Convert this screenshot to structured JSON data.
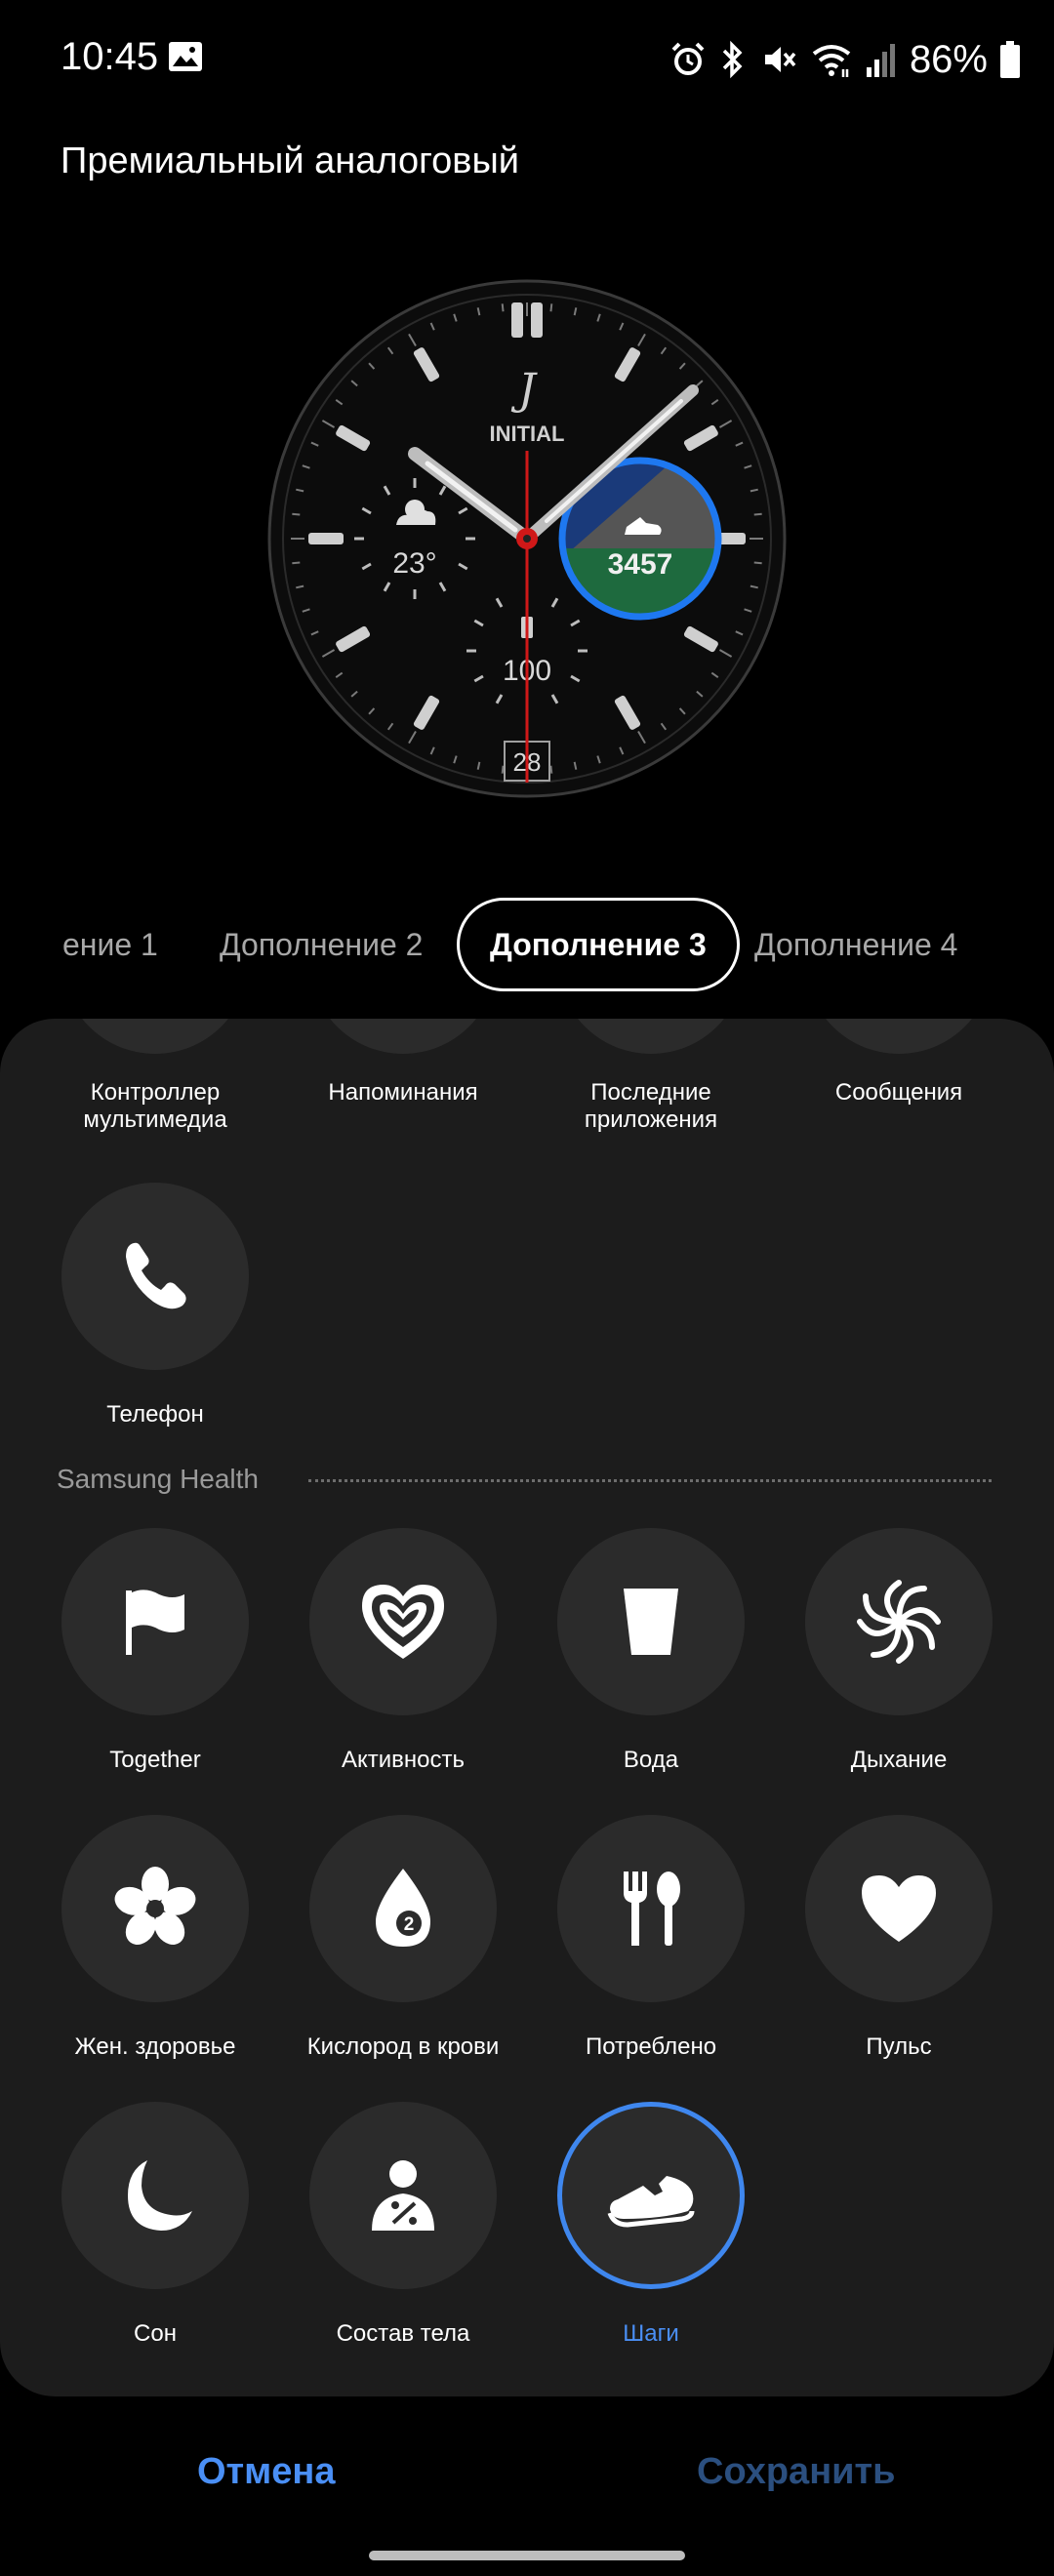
{
  "status": {
    "time": "10:45",
    "battery": "86%"
  },
  "face": {
    "title": "Премиальный аналоговый",
    "brand_initial": "J",
    "brand_text": "INITIAL",
    "weather_temp": "23°",
    "steps_value": "3457",
    "bottom_value": "100",
    "date": "28"
  },
  "tabs": [
    "ение 1",
    "Дополнение 2",
    "Дополнение 3",
    "Дополнение 4"
  ],
  "active_tab": 2,
  "partial_row": [
    "Контроллер\nмультимедиа",
    "Напоминания",
    "Последние\nприложения",
    "Сообщения"
  ],
  "phone_label": "Телефон",
  "section_title": "Samsung Health",
  "health_items": [
    {
      "label": "Together",
      "icon": "flag-icon"
    },
    {
      "label": "Активность",
      "icon": "activity-heart-icon"
    },
    {
      "label": "Вода",
      "icon": "water-cup-icon"
    },
    {
      "label": "Дыхание",
      "icon": "breathing-icon"
    },
    {
      "label": "Жен. здоровье",
      "icon": "flower-icon"
    },
    {
      "label": "Кислород в крови",
      "icon": "oxygen-drop-icon"
    },
    {
      "label": "Потреблено",
      "icon": "fork-spoon-icon"
    },
    {
      "label": "Пульс",
      "icon": "heart-icon"
    },
    {
      "label": "Сон",
      "icon": "moon-icon"
    },
    {
      "label": "Состав тела",
      "icon": "body-composition-icon"
    },
    {
      "label": "Шаги",
      "icon": "shoe-icon"
    }
  ],
  "oxygen_badge": "2",
  "selected_item": "Шаги",
  "buttons": {
    "cancel": "Отмена",
    "save": "Сохранить"
  },
  "colors": {
    "accent": "#4a8ff5",
    "save_disabled": "#2b4f7f",
    "panel": "#1c1c1c",
    "circle": "#2b2b2b"
  }
}
